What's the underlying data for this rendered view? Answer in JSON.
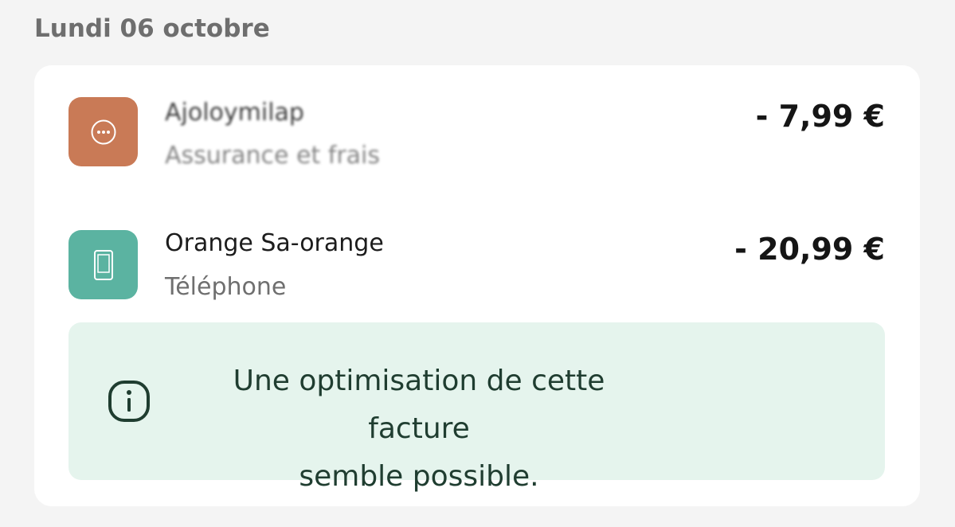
{
  "date_header": "Lundi 06 octobre",
  "transactions": [
    {
      "title": "Ajoloymilap",
      "subtitle": "Assurance et frais",
      "amount": "- 7,99 €",
      "category_icon": "more-dots-icon",
      "icon_color": "#c97a56"
    },
    {
      "title": "Orange Sa-orange",
      "subtitle": "Téléphone",
      "amount": "- 20,99 €",
      "category_icon": "smartphone-icon",
      "icon_color": "#5bb3a1"
    }
  ],
  "info_banner": {
    "line1": "Une optimisation de cette facture",
    "line2": "semble possible.",
    "icon": "info-icon",
    "background": "#e5f4ed"
  }
}
